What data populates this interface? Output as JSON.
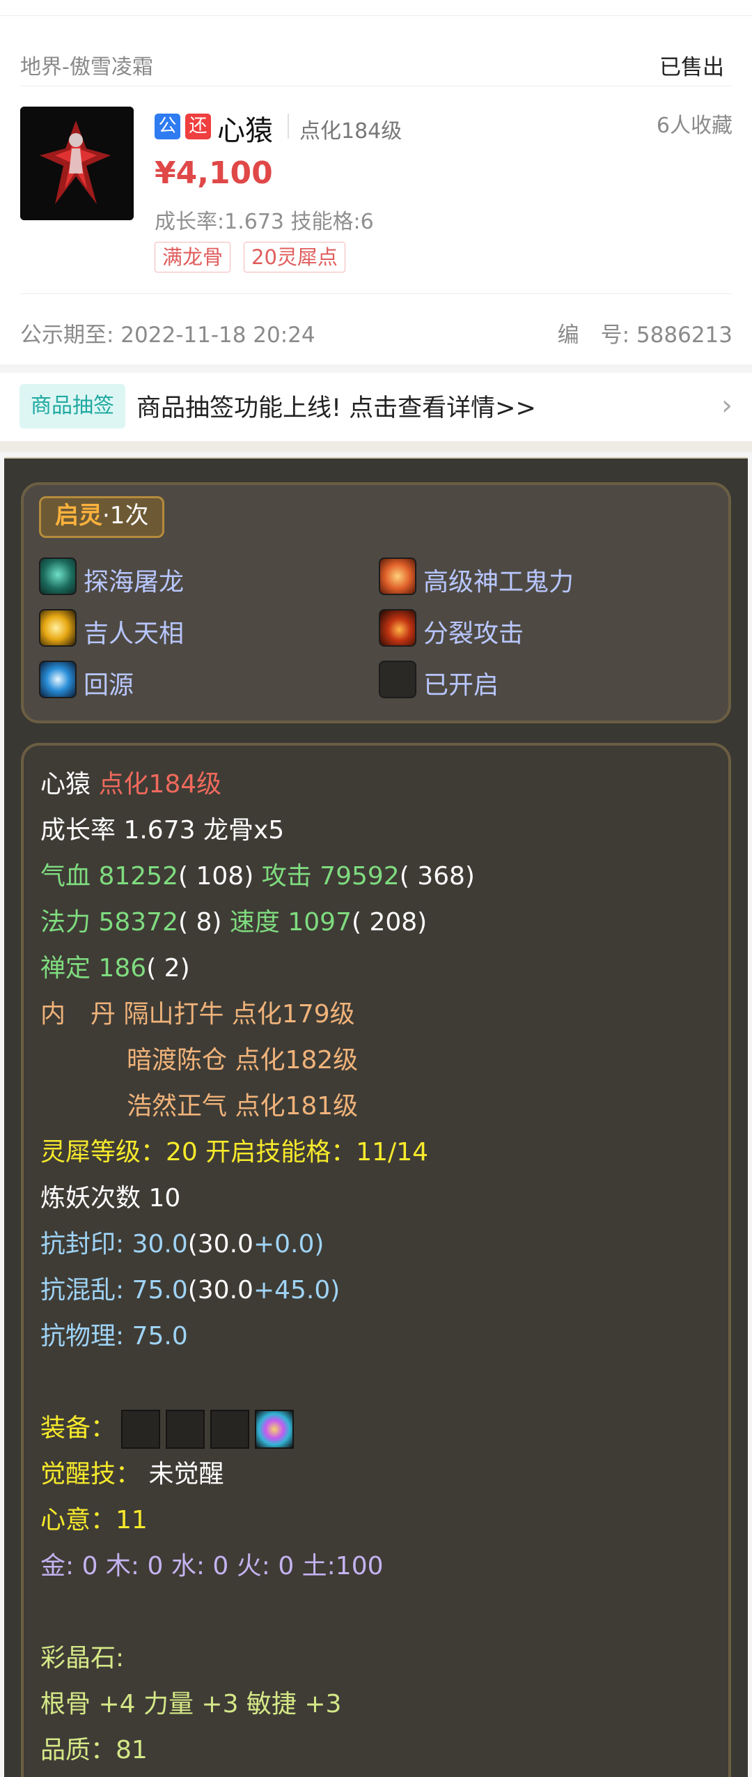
{
  "listing": {
    "server": "地界-傲雪凌霜",
    "status": "已售出",
    "badges": [
      "公",
      "还"
    ],
    "pet_name": "心猿",
    "pet_level": "点化184级",
    "favorites": "6人收藏",
    "price": "¥4,100",
    "growth_info": "成长率:1.673 技能格:6",
    "tags": [
      "满龙骨",
      "20灵犀点"
    ],
    "public_until": "公示期至: 2022-11-18 20:24",
    "serial_label": "编　号: 5886213"
  },
  "notice": {
    "tag": "商品抽签",
    "text": "商品抽签功能上线! 点击查看详情>>",
    "chevron": "chevron-right-icon"
  },
  "qiling": {
    "label": "启灵",
    "count": "·1次"
  },
  "skills": [
    {
      "label": "探海屠龙",
      "icon": "dragon-skill-icon",
      "color": "#1b6b5c"
    },
    {
      "label": "高级神工鬼力",
      "icon": "fist-skill-icon",
      "color": "#e0602a"
    },
    {
      "label": "吉人天相",
      "icon": "sun-skill-icon",
      "color": "#e8a814"
    },
    {
      "label": "分裂攻击",
      "icon": "slash-skill-icon",
      "color": "#c23412"
    },
    {
      "label": "回源",
      "icon": "orb-skill-icon",
      "color": "#2a8ed8"
    },
    {
      "label": "已开启",
      "icon": "locked-slot-icon",
      "color": "#2b2926"
    }
  ],
  "stats": {
    "name": "心猿",
    "level": "点化184级",
    "growth_line": "成长率 1.673 龙骨x5",
    "hp_label": "气血",
    "hp_value": "81252",
    "hp_add": "( 108)",
    "atk_label": "攻击",
    "atk_value": "79592",
    "atk_add": "( 368)",
    "mp_label": "法力",
    "mp_value": "58372",
    "mp_add": "( 8)",
    "spd_label": "速度",
    "spd_value": "1097",
    "spd_add": "( 208)",
    "zen_label": "禅定",
    "zen_value": "186",
    "zen_add": "( 2)",
    "neidan_label": "内　丹",
    "neidan": [
      "隔山打牛 点化179级",
      "暗渡陈仓 点化182级",
      "浩然正气 点化181级"
    ],
    "lingxi_line": "灵犀等级：20 开启技能格：11/14",
    "lianyao_line": "炼妖次数 10",
    "resist_seal_label": "抗封印: ",
    "resist_seal_value": "30.0",
    "resist_seal_paren_open": "(",
    "resist_seal_base": "30.0",
    "resist_seal_bonus": "+0.0)",
    "resist_chaos_label": "抗混乱: ",
    "resist_chaos_value": "75.0",
    "resist_chaos_paren_open": "(",
    "resist_chaos_base": "30.0",
    "resist_chaos_bonus": "+45.0)",
    "resist_phys_line": "抗物理: 75.0",
    "equip_label": "装备：",
    "awaken_label": "觉醒技：",
    "awaken_value": "未觉醒",
    "xinyi_line": "心意：11",
    "elements_line": "金: 0 木: 0 水: 0 火: 0 土:100",
    "crystal_label": "彩晶石:",
    "crystal_attrs": "根骨 +4 力量 +3 敏捷 +3",
    "quality_line": "品质：81"
  },
  "colors": {
    "price": "#e04848",
    "detail_bg": "#3a3833",
    "skill_text": "#b8c6ff",
    "stat_green": "#7fdc7f",
    "stat_yellow": "#f7ea2c",
    "stat_orange": "#f0b37a",
    "stat_cyan": "#9fd4f6"
  }
}
